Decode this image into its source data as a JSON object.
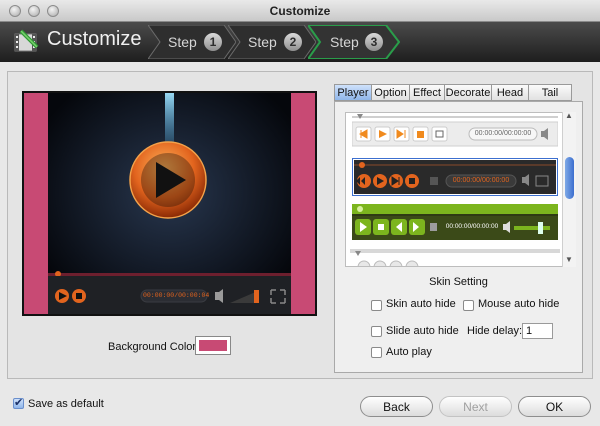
{
  "window": {
    "title": "Customize"
  },
  "header": {
    "title": "Customize",
    "steps": [
      {
        "label": "Step",
        "number": "1"
      },
      {
        "label": "Step",
        "number": "2"
      },
      {
        "label": "Step",
        "number": "3"
      }
    ],
    "active_step": 3
  },
  "preview": {
    "time": "00:00:00/00:00:04",
    "background_color_label": "Background Color:",
    "background_color": "#c84a74"
  },
  "tabs": [
    {
      "label": "Player",
      "active": true
    },
    {
      "label": "Option",
      "active": false
    },
    {
      "label": "Effect",
      "active": false
    },
    {
      "label": "Decorate",
      "active": false
    },
    {
      "label": "Head",
      "active": false
    },
    {
      "label": "Tail",
      "active": false
    }
  ],
  "skins": [
    {
      "time": "00:00:00/00:00:00"
    },
    {
      "time": "00:00:00/00:00:00"
    },
    {
      "time": "00:00:00/00:00:00"
    }
  ],
  "skin_setting": {
    "title": "Skin Setting",
    "skin_auto_hide": {
      "label": "Skin auto hide",
      "checked": false
    },
    "mouse_auto_hide": {
      "label": "Mouse auto hide",
      "checked": false
    },
    "slide_auto_hide": {
      "label": "Slide auto hide",
      "checked": false
    },
    "hide_delay": {
      "label": "Hide delay:",
      "value": "1"
    },
    "auto_play": {
      "label": "Auto play",
      "checked": false
    }
  },
  "footer": {
    "save_default": {
      "label": "Save as default",
      "checked": true
    },
    "back_label": "Back",
    "next_label": "Next",
    "ok_label": "OK"
  },
  "colors": {
    "accent_blue": "#3c6fcf",
    "header_dark": "#1e1e1e",
    "step_active": "#2a9d4a"
  }
}
